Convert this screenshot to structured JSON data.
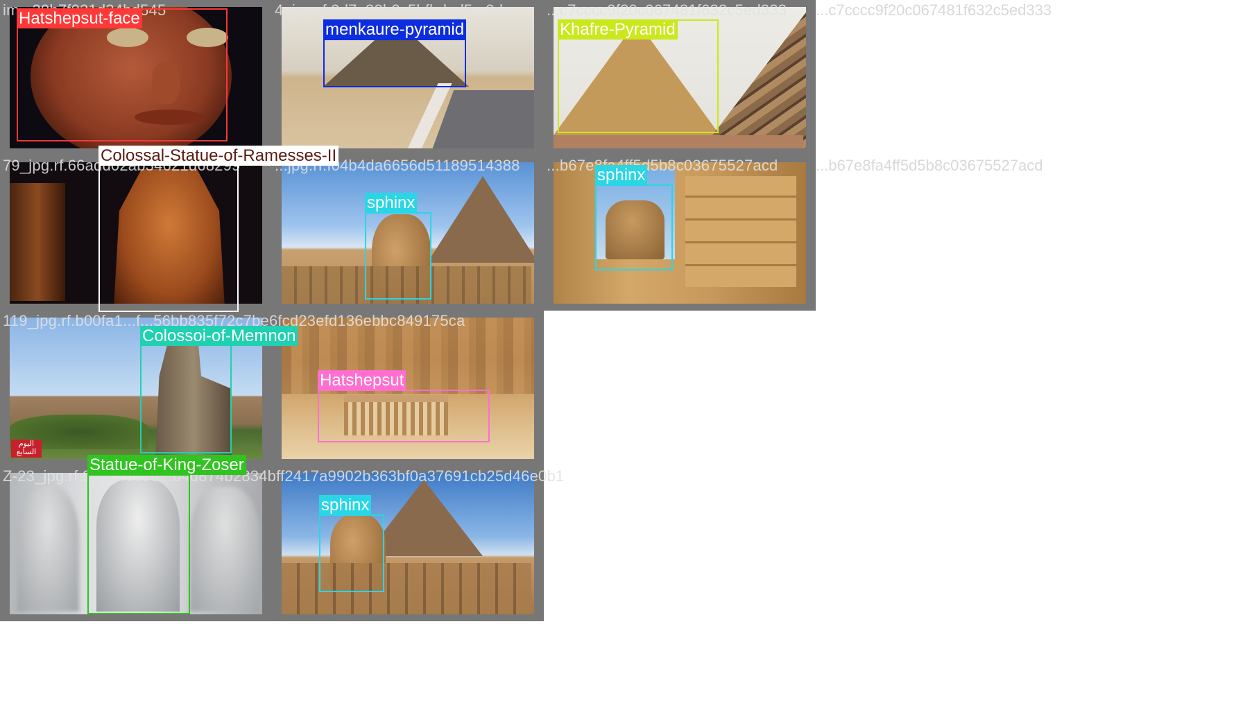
{
  "colors": {
    "hatshepsut_face": "#ff3838",
    "menkaure_pyramid": "#0c2ce0",
    "khafre_pyramid": "#cbe81c",
    "colossal_statue": "#ffffff",
    "sphinx": "#29d6e6",
    "colossoi": "#1fd1b0",
    "hatshepsut": "#ff6ed0",
    "zoser": "#2fc41f"
  },
  "tiles": [
    {
      "filename": "im...39b7f021d34bd545",
      "label": "Hatshepsut-face"
    },
    {
      "filename": "4_jpg.rf.9d7e88b2c5bfbded5...2d",
      "label": "menkaure-pyramid"
    },
    {
      "filename": "...c7cccc9f20c067481f632c5ed333",
      "label": "Khafre-Pyramid"
    },
    {
      "filename": "79_jpg.rf.66add02ab34621d68299",
      "label": "Colossal-Statue-of-Ramesses-II"
    },
    {
      "filename": "...jpg.rf.f04b4da6656d51189514388",
      "label": "sphinx"
    },
    {
      "filename": "...b67e8fa4ff5d5b8c03675527acd",
      "label": "sphinx"
    },
    {
      "filename": "119_jpg.rf.b00fa1...f...56bb835f72c7be6fcd23efd136ebbc849175ca",
      "label": "Colossoi-of-Memnon"
    },
    {
      "filename": "",
      "label": "Hatshepsut"
    },
    {
      "filename": "Z-23_jpg.rf.2fe0...dc95...b4d874b2834bff2417a9902b363bf0a37691cb25d46e0b1",
      "label": "Statue-of-King-Zoser"
    },
    {
      "filename": "",
      "label": "sphinx"
    }
  ],
  "watermark": "اليوم السابع"
}
